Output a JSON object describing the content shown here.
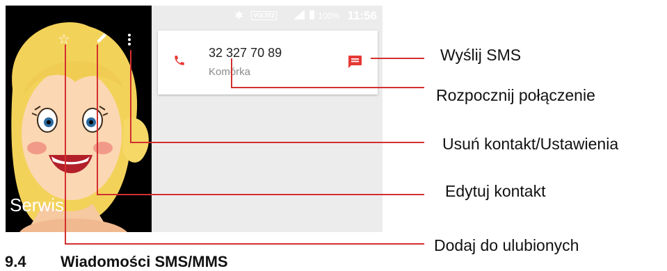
{
  "status_bar": {
    "bluetooth_icon": "bluetooth-icon",
    "volte": "VOLTE2",
    "battery": "100%",
    "time": "11:56"
  },
  "contact": {
    "name": "Serwis",
    "phone_number": "32 327 70 89",
    "phone_type": "Komórka"
  },
  "callouts": {
    "send_sms": "Wyślij SMS",
    "start_call": "Rozpocznij połączenie",
    "delete_settings": "Usuń kontakt/Ustawienia",
    "edit_contact": "Edytuj kontakt",
    "add_favorite": "Dodaj do ulubionych"
  },
  "section": {
    "number": "9.4",
    "title": "Wiadomości SMS/MMS"
  },
  "colors": {
    "accent": "#e53935",
    "callout_line": "#d32f2f"
  }
}
